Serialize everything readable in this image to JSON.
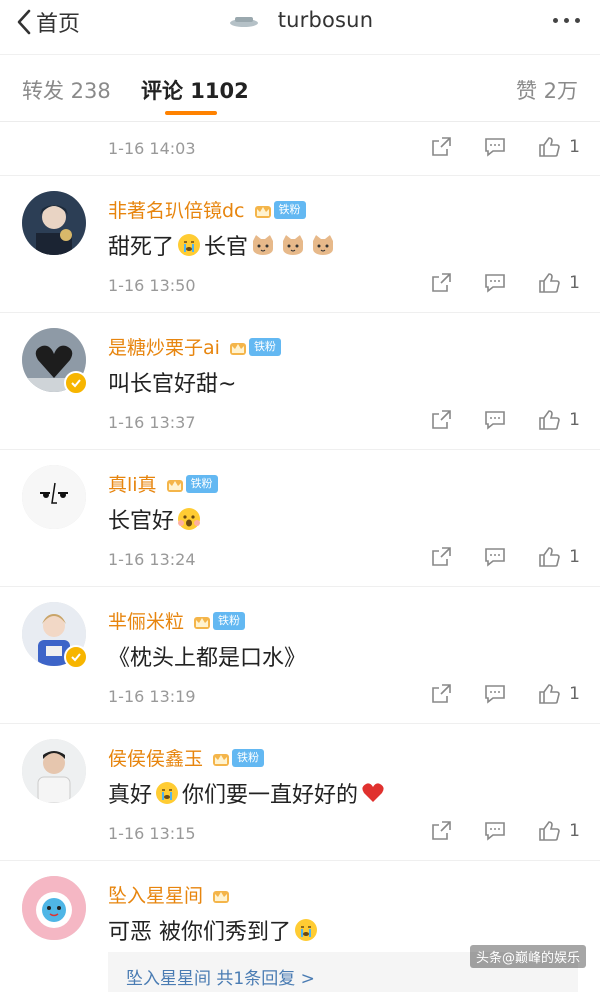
{
  "nav": {
    "back_label": "首页",
    "title": "turbosun"
  },
  "tabs": {
    "repost": "转发 238",
    "comments": "评论 1102",
    "likes": "赞 2万"
  },
  "fan_badge": "铁粉",
  "colors": {
    "accent": "#ff8200",
    "username": "#e7850e",
    "badge": "#63b8f2",
    "link": "#4a7cb3"
  },
  "comments": [
    {
      "time": "1-16 14:03",
      "likes": "1"
    },
    {
      "user": "非著名玐倍镜dc",
      "text": "甜死了",
      "text2": "长官",
      "time": "1-16 13:50",
      "likes": "1",
      "verified": false,
      "badge": true
    },
    {
      "user": "是糖炒栗子ai",
      "text": "叫长官好甜~",
      "time": "1-16 13:37",
      "likes": "1",
      "verified": true,
      "badge": true
    },
    {
      "user": "真li真",
      "text": "长官好",
      "time": "1-16 13:24",
      "likes": "1",
      "verified": false,
      "badge": true
    },
    {
      "user": "芈俪米粒",
      "text": "《枕头上都是口水》",
      "time": "1-16 13:19",
      "likes": "1",
      "verified": true,
      "badge": true
    },
    {
      "user": "侯侯侯鑫玉",
      "text": "真好",
      "text2": "你们要一直好好的",
      "time": "1-16 13:15",
      "likes": "1",
      "verified": false,
      "badge": true
    },
    {
      "user": "坠入星星间",
      "text": "可恶 被你们秀到了",
      "verified": false,
      "badge": false
    }
  ],
  "reply_summary": "坠入星星间 共1条回复 >",
  "watermark": "头条@巅峰的娱乐"
}
